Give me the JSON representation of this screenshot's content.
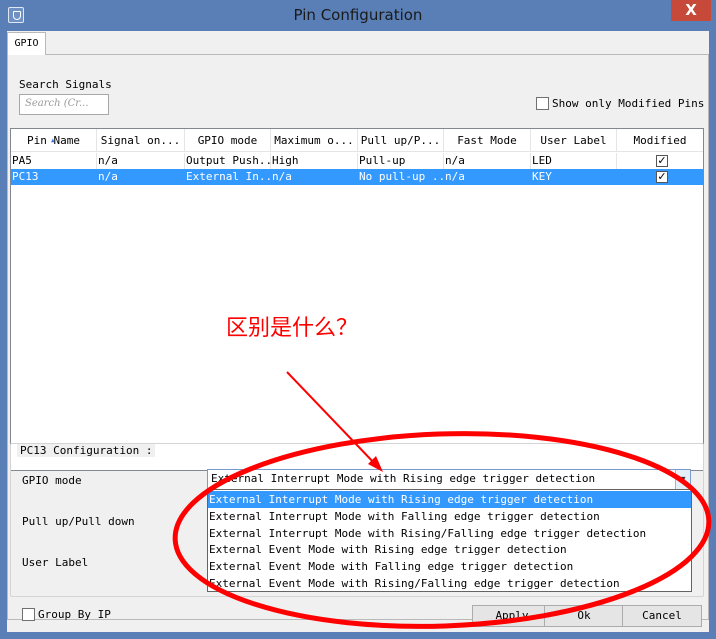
{
  "window": {
    "title": "Pin Configuration",
    "close_glyph": "X"
  },
  "tabs": [
    {
      "label": "GPIO"
    }
  ],
  "search": {
    "label": "Search Signals",
    "placeholder": "Search (Cr..."
  },
  "show_modified": {
    "label": "Show only Modified Pins",
    "checked": false
  },
  "table": {
    "columns": [
      "Pin Name",
      "Signal on...",
      "GPIO mode",
      "Maximum o...",
      "Pull up/P...",
      "Fast Mode",
      "User Label",
      "Modified"
    ],
    "rows": [
      {
        "pin": "PA5",
        "signal": "n/a",
        "mode": "Output Push...",
        "max": "High",
        "pull": "Pull-up",
        "fast": "n/a",
        "label": "LED",
        "modified": true,
        "selected": false
      },
      {
        "pin": "PC13",
        "signal": "n/a",
        "mode": "External In...",
        "max": "n/a",
        "pull": "No pull-up ...",
        "fast": "n/a",
        "label": "KEY",
        "modified": true,
        "selected": true
      }
    ]
  },
  "config": {
    "group_label": "PC13 Configuration :",
    "gpio_mode_label": "GPIO mode",
    "pull_label": "Pull up/Pull down",
    "user_label": "User Label",
    "gpio_mode_value": "External Interrupt Mode with Rising edge trigger detection",
    "options": [
      "External Interrupt Mode with Rising edge trigger detection",
      "External Interrupt Mode with Falling edge trigger detection",
      "External Interrupt Mode with Rising/Falling edge trigger detection",
      "External Event Mode with Rising edge trigger detection",
      "External Event Mode with Falling edge trigger detection",
      "External Event Mode with Rising/Falling edge trigger detection"
    ],
    "selected_option": 0
  },
  "footer": {
    "group_by_ip": "Group By IP",
    "apply": "Apply",
    "ok": "Ok",
    "cancel": "Cancel"
  },
  "annotation": {
    "text": "区别是什么？",
    "color": "#ff0000"
  },
  "colors": {
    "titlebar": "#5a7fb6",
    "selection": "#3399ff",
    "close": "#c7493a"
  }
}
